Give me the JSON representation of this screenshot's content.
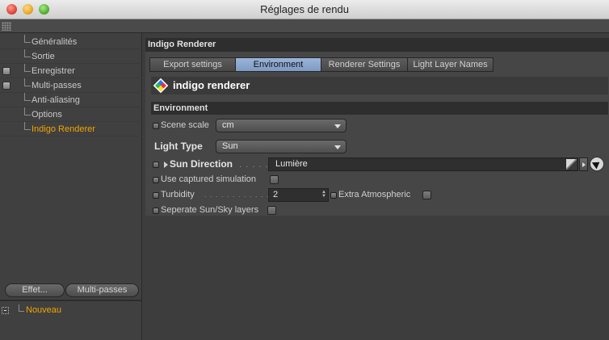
{
  "window": {
    "title": "Réglages de rendu"
  },
  "sidebar": {
    "items": [
      {
        "label": "Généralités",
        "has_check": false,
        "active": false
      },
      {
        "label": "Sortie",
        "has_check": false,
        "active": false
      },
      {
        "label": "Enregistrer",
        "has_check": true,
        "active": false
      },
      {
        "label": "Multi-passes",
        "has_check": true,
        "active": false
      },
      {
        "label": "Anti-aliasing",
        "has_check": false,
        "active": false
      },
      {
        "label": "Options",
        "has_check": false,
        "active": false
      },
      {
        "label": "Indigo Renderer",
        "has_check": false,
        "active": true
      }
    ],
    "effect_button": "Effet...",
    "multipass_button": "Multi-passes",
    "preset_label": "Nouveau"
  },
  "panel": {
    "title": "Indigo Renderer",
    "tabs": [
      {
        "label": "Export settings",
        "selected": false
      },
      {
        "label": "Environment",
        "selected": true
      },
      {
        "label": "Renderer Settings",
        "selected": false
      },
      {
        "label": "Light Layer Names",
        "selected": false
      }
    ],
    "logo_text": "indigo renderer",
    "section_title": "Environment",
    "scene_scale": {
      "label": "Scene scale",
      "value": "cm"
    },
    "light_type": {
      "label": "Light Type",
      "value": "Sun"
    },
    "sun_direction": {
      "label": "Sun Direction",
      "leader": ". . . . . .",
      "value": "Lumière"
    },
    "use_captured": {
      "label": "Use captured simulation"
    },
    "turbidity": {
      "label": "Turbidity",
      "leader": ". . . . . . . . . . . . .",
      "value": "2"
    },
    "extra_atmospheric": {
      "label": "Extra Atmospheric"
    },
    "separate_layers": {
      "label": "Seperate Sun/Sky layers"
    }
  },
  "colors": {
    "accent_orange": "#f0a400",
    "selected_tab": "#8ea8cf",
    "background": "#3d3d3d"
  }
}
